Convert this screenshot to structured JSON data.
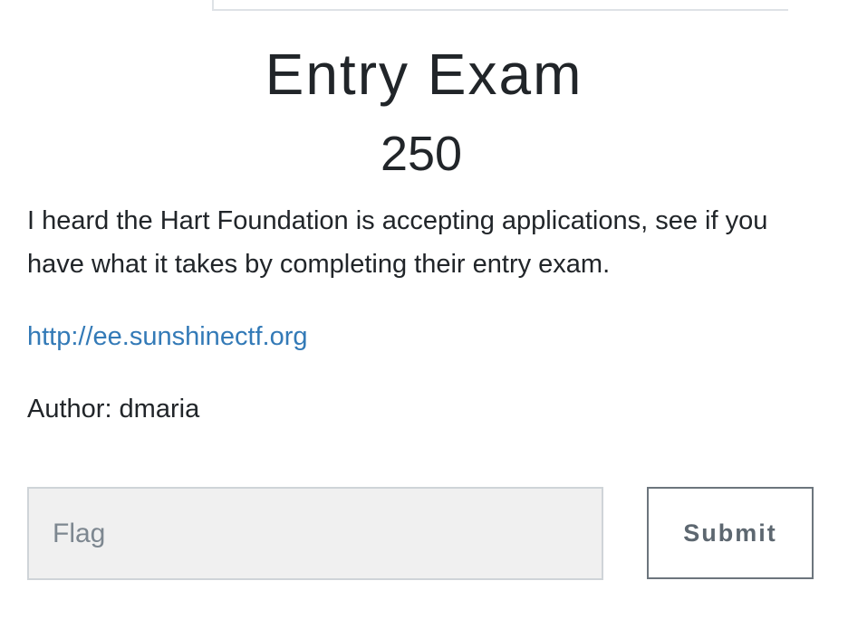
{
  "challenge": {
    "title": "Entry Exam",
    "points": "250",
    "description": "I heard the Hart Foundation is accepting applications, see if you have what it takes by completing their entry exam.",
    "link": "http://ee.sunshinectf.org",
    "author": "Author: dmaria"
  },
  "form": {
    "flag_placeholder": "Flag",
    "flag_value": "",
    "submit_label": "Submit"
  },
  "colors": {
    "link": "#337ab7",
    "input_background": "#f0f0f0",
    "button_border": "#6c757d"
  }
}
